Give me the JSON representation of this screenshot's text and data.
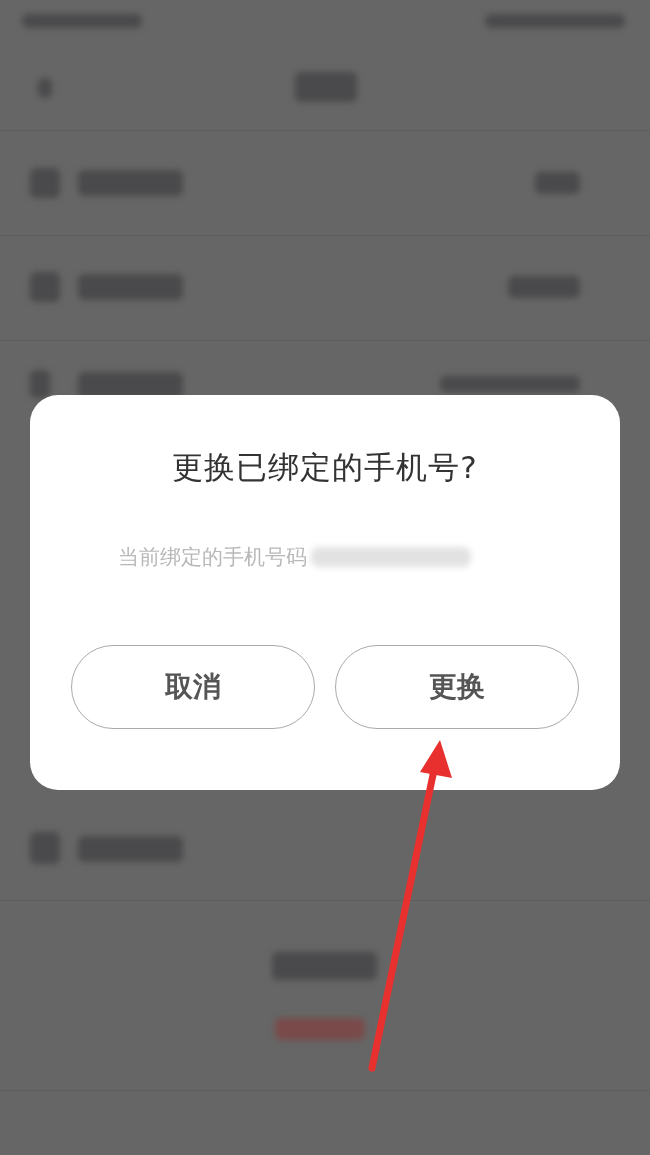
{
  "dialog": {
    "title": "更换已绑定的手机号?",
    "message": "当前绑定的手机号码",
    "buttons": [
      {
        "label": "取消"
      },
      {
        "label": "更换"
      }
    ]
  }
}
